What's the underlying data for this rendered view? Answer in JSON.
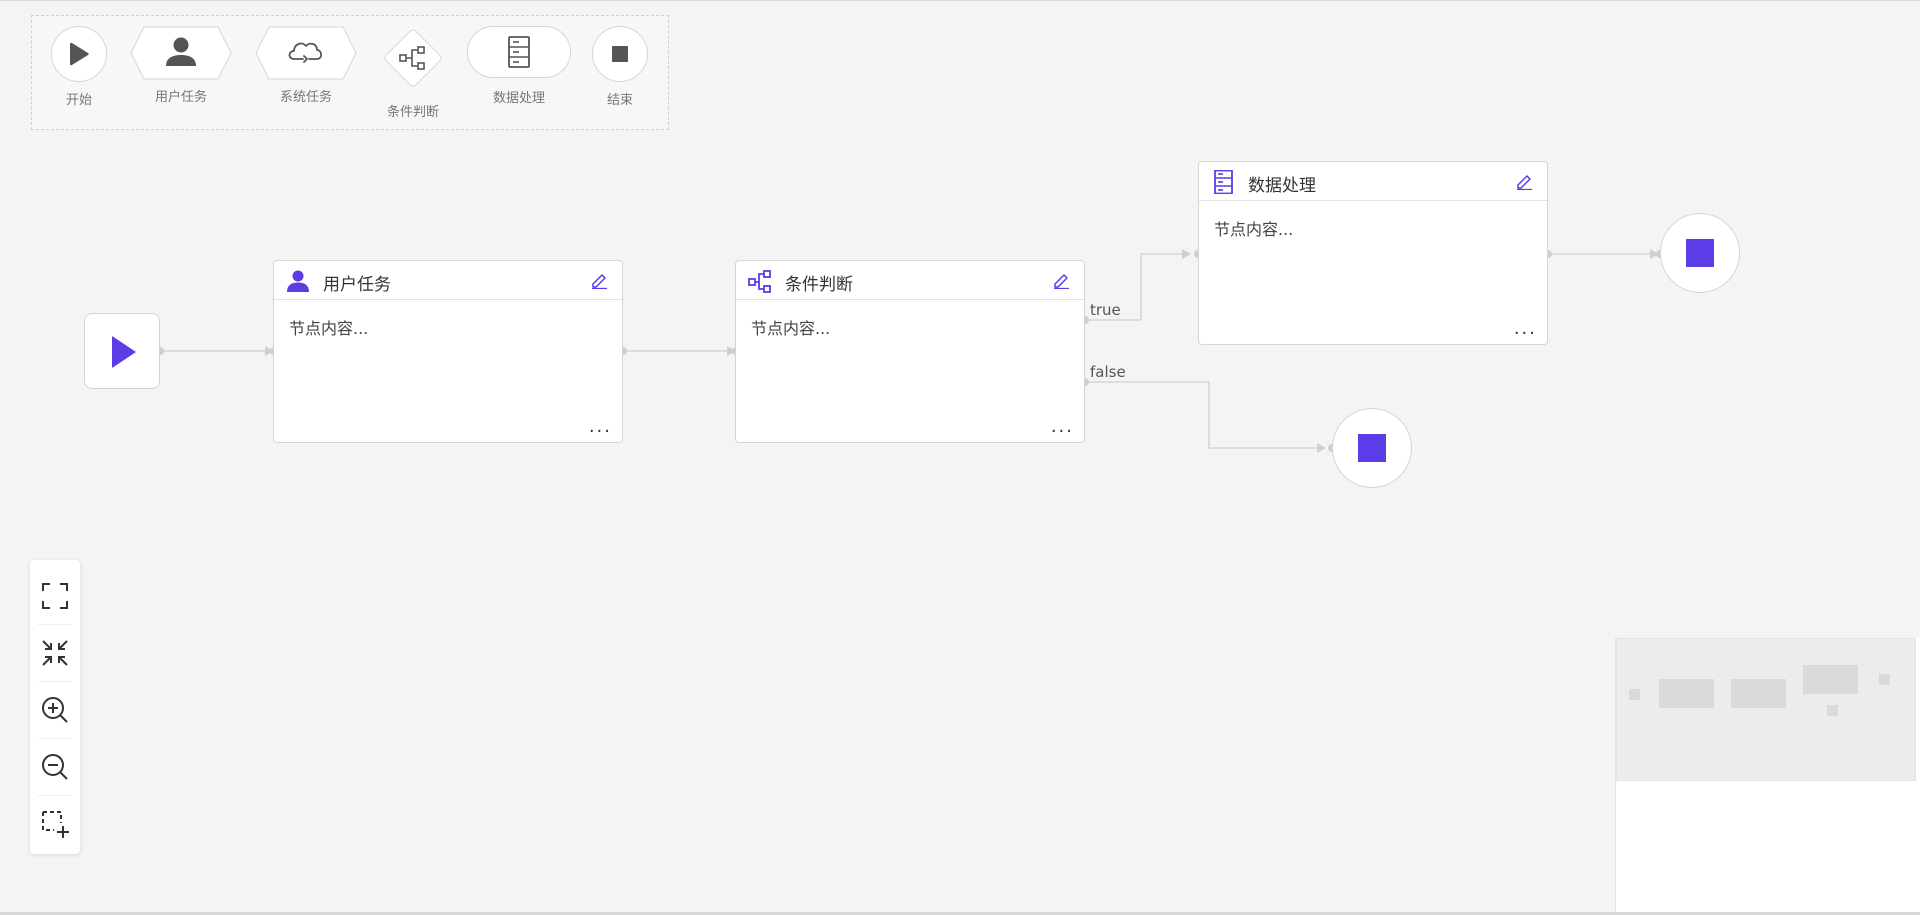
{
  "palette": {
    "items": [
      {
        "label": "开始",
        "icon": "play-icon"
      },
      {
        "label": "用户任务",
        "icon": "user-icon"
      },
      {
        "label": "系统任务",
        "icon": "cloud-icon"
      },
      {
        "label": "条件判断",
        "icon": "branch-icon"
      },
      {
        "label": "数据处理",
        "icon": "server-icon"
      },
      {
        "label": "结束",
        "icon": "stop-icon"
      }
    ]
  },
  "canvas": {
    "nodes": [
      {
        "title": "用户任务",
        "body": "节点内容...",
        "icon": "user-icon"
      },
      {
        "title": "条件判断",
        "body": "节点内容...",
        "icon": "branch-icon"
      },
      {
        "title": "数据处理",
        "body": "节点内容...",
        "icon": "server-icon"
      }
    ],
    "edges": {
      "true_label": "true",
      "false_label": "false"
    },
    "more_label": "...",
    "accent_color": "#5b3ce6"
  },
  "toolbar": {
    "tools": [
      {
        "icon": "fullscreen-icon"
      },
      {
        "icon": "fit-view-icon"
      },
      {
        "icon": "zoom-in-icon"
      },
      {
        "icon": "zoom-out-icon"
      },
      {
        "icon": "box-select-icon"
      }
    ]
  }
}
